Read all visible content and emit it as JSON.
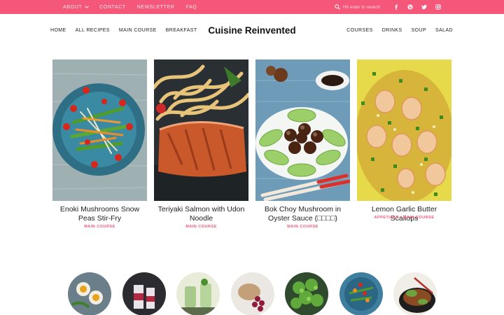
{
  "topbar": {
    "nav": [
      "ABOUT",
      "CONTACT",
      "NEWSLETTER",
      "FAQ"
    ],
    "search_placeholder": "Hit enter to search",
    "social_icons": [
      "facebook-icon",
      "pinterest-icon",
      "twitter-icon",
      "instagram-icon"
    ],
    "accent": "#f4577a"
  },
  "header": {
    "nav_left": [
      "HOME",
      "ALL RECIPES",
      "MAIN COURSE",
      "BREAKFAST"
    ],
    "brand": "Cuisine Reinvented",
    "nav_right": [
      "COURSES",
      "DRINKS",
      "SOUP",
      "SALAD"
    ]
  },
  "cards": [
    {
      "title": "Enoki Mushrooms Snow Peas Stir-Fry",
      "category": "MAIN COURSE"
    },
    {
      "title": "Teriyaki Salmon with Udon Noodle",
      "category": "MAIN COURSE"
    },
    {
      "title": "Bok Choy Mushroom in Oyster Sauce (□□□□)",
      "category": "MAIN COURSE"
    },
    {
      "title": "Lemon Garlic Butter Scallops",
      "category": "APPETIZER / MAIN COURSE"
    }
  ]
}
